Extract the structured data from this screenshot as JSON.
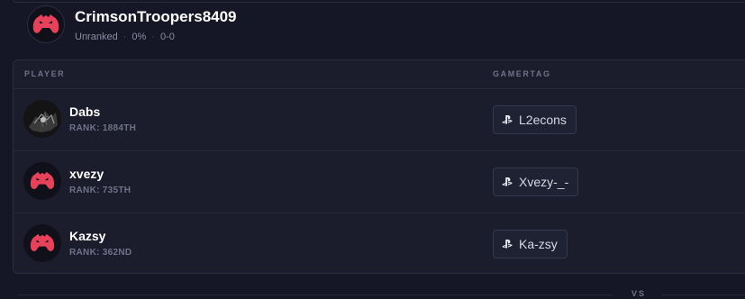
{
  "team": {
    "name": "CrimsonTroopers8409",
    "status": "Unranked",
    "win_rate": "0%",
    "record": "0-0"
  },
  "roster": {
    "columns": {
      "player": "PLAYER",
      "gamertag": "GAMERTAG"
    },
    "players": [
      {
        "name": "Dabs",
        "rank": "RANK: 1884TH",
        "gamertag": "L2econs",
        "platform_icon": "playstation-icon"
      },
      {
        "name": "xvezy",
        "rank": "RANK: 735TH",
        "gamertag": "Xvezy-_-",
        "platform_icon": "playstation-icon"
      },
      {
        "name": "Kazsy",
        "rank": "RANK: 362ND",
        "gamertag": "Ka-zsy",
        "platform_icon": "playstation-icon"
      }
    ]
  },
  "divider": {
    "label": "VS"
  },
  "colors": {
    "background": "#151726",
    "card": "#1b1d2d",
    "avatar_accent": "#e8415a"
  }
}
